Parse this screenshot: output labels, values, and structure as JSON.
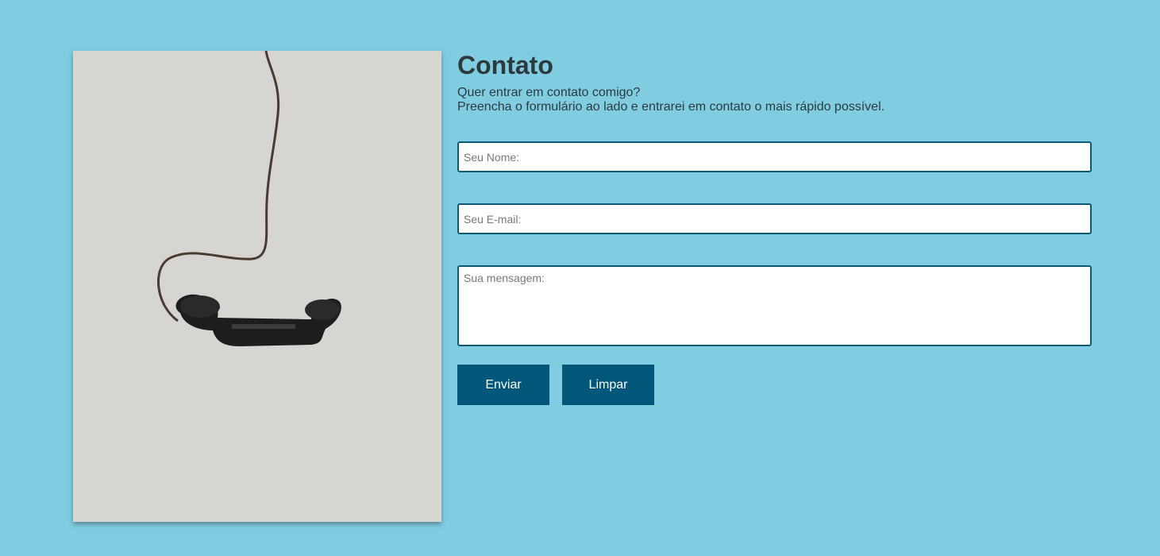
{
  "contact": {
    "title": "Contato",
    "intro_line1": "Quer entrar em contato comigo?",
    "intro_line2": "Preencha o formulário ao lado e entrarei em contato o mais rápido possível."
  },
  "form": {
    "name_placeholder": "Seu Nome:",
    "email_placeholder": "Seu E-mail:",
    "message_placeholder": "Sua mensagem:",
    "submit_label": "Enviar",
    "reset_label": "Limpar"
  },
  "colors": {
    "background": "#80cde2",
    "button": "#03577a",
    "field_border": "#0f5a73",
    "text": "#2c3a3e"
  }
}
